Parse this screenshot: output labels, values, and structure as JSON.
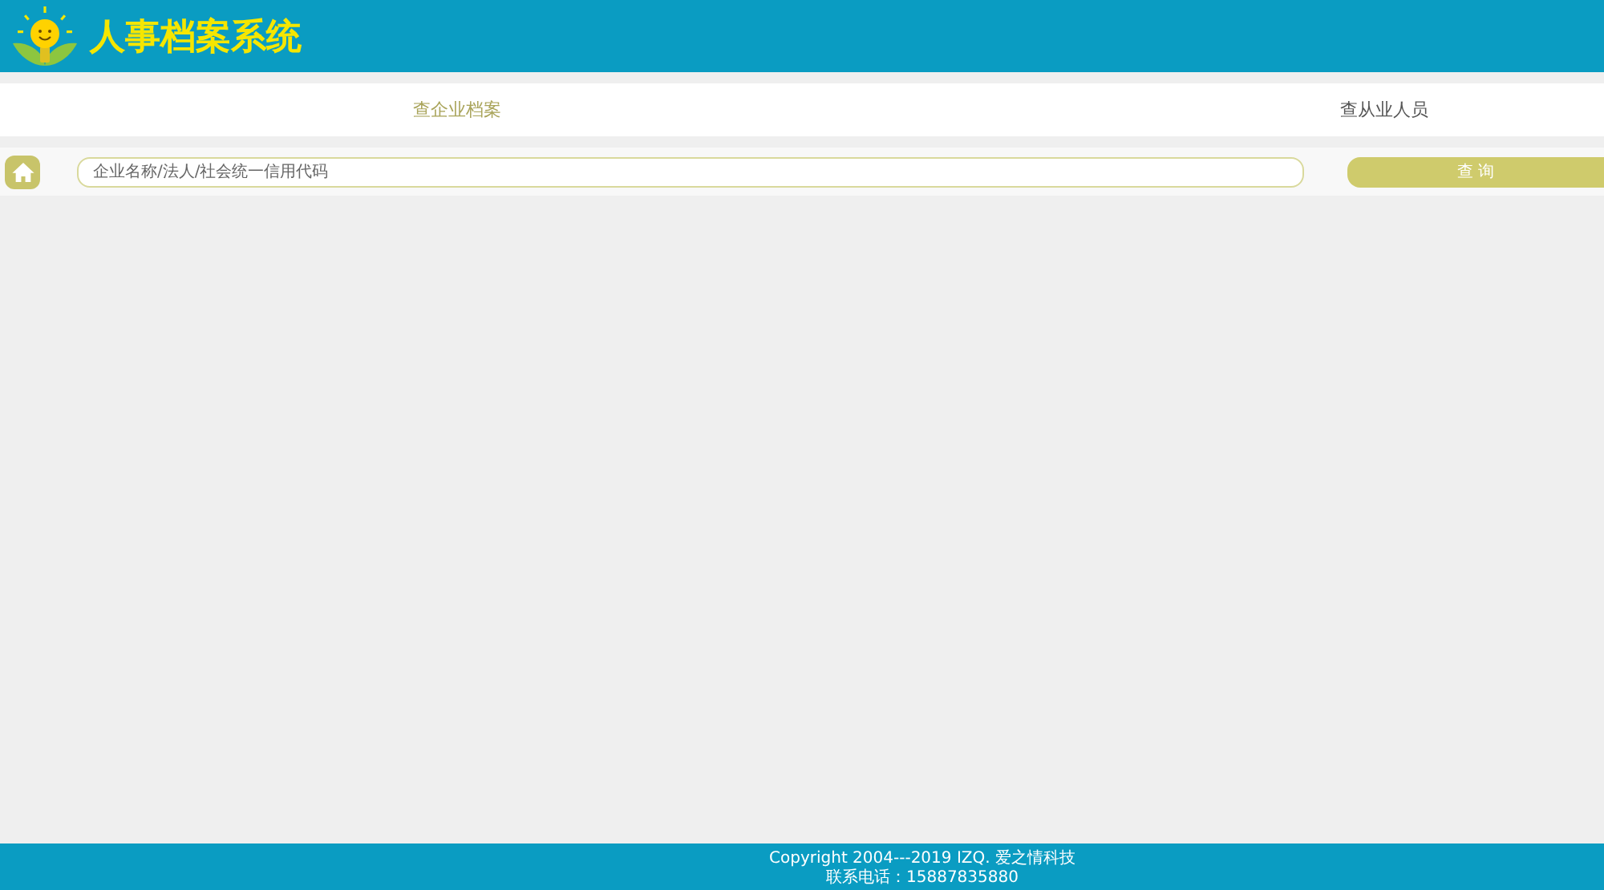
{
  "header": {
    "title": "人事档案系统"
  },
  "tabs": [
    {
      "label": "查企业档案",
      "selected": true
    },
    {
      "label": "查从业人员",
      "selected": false
    }
  ],
  "search": {
    "placeholder": "企业名称/法人/社会统一信用代码",
    "button": "查 询"
  },
  "footer": {
    "lines": [
      "Copyright 2004---2019 IZQ. 爱之情科技",
      "联系电话：15887835880"
    ]
  }
}
